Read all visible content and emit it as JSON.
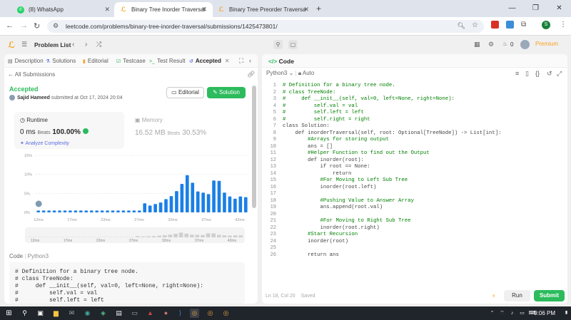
{
  "browser": {
    "tabs": [
      {
        "title": "(8) WhatsApp",
        "icon": "whatsapp-icon",
        "color": "#25d366",
        "active": false
      },
      {
        "title": "Binary Tree Inorder Traversal - L",
        "icon": "leetcode-icon",
        "color": "#f89f1b",
        "active": true
      },
      {
        "title": "Binary Tree Preorder Traversal - ",
        "icon": "leetcode-icon",
        "color": "#f89f1b",
        "active": false
      }
    ],
    "url": "leetcode.com/problems/binary-tree-inorder-traversal/submissions/1425473801/",
    "profile_initial": "S"
  },
  "header": {
    "problem_list": "Problem List",
    "streak": "0",
    "premium": "Premium"
  },
  "left": {
    "tabs": [
      {
        "label": "Description",
        "icon": "description-icon"
      },
      {
        "label": "Solutions",
        "icon": "flask-icon"
      },
      {
        "label": "Editorial",
        "icon": "book-icon"
      },
      {
        "label": "Testcase",
        "icon": "check-box-icon"
      },
      {
        "label": "Test Result",
        "icon": "terminal-icon"
      },
      {
        "label": "Accepted",
        "icon": "history-icon"
      }
    ],
    "all_submissions": "All Submissions",
    "status": "Accepted",
    "author": "Sajid Hameed",
    "submitted_text": "submitted at Oct 17, 2024 20:04",
    "editorial_btn": "Editorial",
    "solution_btn": "Solution",
    "runtime": {
      "label": "Runtime",
      "value": "0 ms",
      "beats_label": "Beats",
      "beats_value": "100.00%",
      "analyze": "Analyze Complexity"
    },
    "memory": {
      "label": "Memory",
      "value": "16.52 MB",
      "beats_label": "Beats",
      "beats_value": "30.53%"
    },
    "code_label": "Code",
    "code_lang": "Python3",
    "code_preview": [
      "# Definition for a binary tree node.",
      "# class TreeNode:",
      "#     def __init__(self, val=0, left=None, right=None):",
      "#         self.val = val",
      "#         self.left = left"
    ]
  },
  "chart_data": {
    "type": "bar",
    "ylabel_ticks": [
      "15%",
      "10%",
      "5%",
      "0%"
    ],
    "ylim": [
      0,
      15
    ],
    "x_ticks": [
      "12ms",
      "17ms",
      "22ms",
      "27ms",
      "32ms",
      "37ms",
      "42ms"
    ],
    "mini_x_ticks": [
      "12ms",
      "17ms",
      "22ms",
      "27ms",
      "32ms",
      "37ms",
      "42ms"
    ],
    "values": [
      0.5,
      0.5,
      0.5,
      0.5,
      0.5,
      0.5,
      0.5,
      0.5,
      0.5,
      0.5,
      0.5,
      0.5,
      0.5,
      0.5,
      0.5,
      0.5,
      0.5,
      0.5,
      0.5,
      0.5,
      2.4,
      1.8,
      2.2,
      2.6,
      3.5,
      4.3,
      5.6,
      7.5,
      9.8,
      7.8,
      5.5,
      5.2,
      4.8,
      8.4,
      8.3,
      5.2,
      4.2,
      3.6,
      4.2,
      4.0
    ],
    "highlight_color": "#1a7fe6"
  },
  "right": {
    "title": "Code",
    "lang": "Python3",
    "mode": "Auto",
    "code": [
      "# Definition for a binary tree node.",
      "# class TreeNode:",
      "#     def __init__(self, val=0, left=None, right=None):",
      "#         self.val = val",
      "#         self.left = left",
      "#         self.right = right",
      "class Solution:",
      "    def inorderTraversal(self, root: Optional[TreeNode]) -> List[int]:",
      "        #Arrays for storing output",
      "        ans = []",
      "        #Helper Function to find out the Output",
      "        def inorder(root):",
      "            if root == None:",
      "                return",
      "            #For Moving to Left Sub Tree",
      "            inorder(root.left)",
      "",
      "            #Pushing Value to Answer Array",
      "            ans.append(root.val)",
      "",
      "            #For Moving to Right Sub Tree",
      "            inorder(root.right)",
      "        #Start Recursion",
      "        inorder(root)",
      "",
      "        return ans"
    ],
    "status": "Ln 18, Col 20",
    "saved": "Saved",
    "run": "Run",
    "submit": "Submit"
  },
  "taskbar": {
    "time": "9:06 PM"
  }
}
